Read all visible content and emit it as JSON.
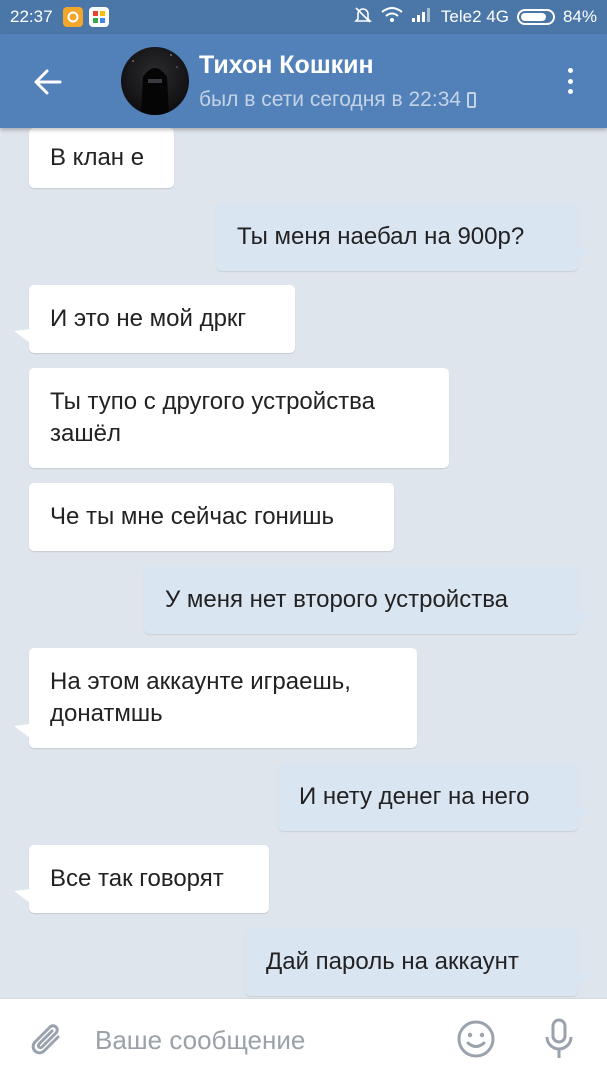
{
  "status_bar": {
    "time": "22:37",
    "carrier": "Tele2 4G",
    "battery": "84%",
    "battery_level": 0.84,
    "icons": [
      "orange-app-notification-icon",
      "colorful-app-notification-icon",
      "mute-icon",
      "wifi-icon",
      "signal-icon",
      "battery-icon"
    ]
  },
  "header": {
    "contact_name": "Тихон Кошкин",
    "contact_status": "был в сети сегодня в 22:34",
    "icons": [
      "back-arrow-icon",
      "avatar",
      "mobile-phone-icon",
      "more-vertical-icon"
    ]
  },
  "colors": {
    "header_bg": "#5181b8",
    "status_bar_bg": "#4a76a8",
    "chat_bg": "#dfe5ec",
    "incoming_bubble": "#ffffff",
    "outgoing_bubble": "#dae5f2"
  },
  "messages": [
    {
      "direction": "in",
      "text": "В клан е",
      "tail": false
    },
    {
      "direction": "out",
      "text": "Ты меня наебал на 900р?",
      "tail": true
    },
    {
      "direction": "in",
      "text": "И это не мой дркг",
      "tail": true
    },
    {
      "direction": "in",
      "text": "Ты тупо с другого устройства зашёл",
      "tail": false
    },
    {
      "direction": "in",
      "text": "Че ты мне сейчас гонишь",
      "tail": false
    },
    {
      "direction": "out",
      "text": "У меня нет второго устройства",
      "tail": true
    },
    {
      "direction": "in",
      "text": "На этом аккаунте играешь, донатмшь",
      "tail": true
    },
    {
      "direction": "out",
      "text": "И нету денег на него",
      "tail": true
    },
    {
      "direction": "in",
      "text": "Все так говорят",
      "tail": true
    },
    {
      "direction": "out",
      "text": "Дай пароль на аккаунт",
      "tail": true
    }
  ],
  "composer": {
    "placeholder": "Ваше сообщение",
    "value": "",
    "icons": [
      "attach-paperclip-icon",
      "emoji-smile-icon",
      "microphone-icon"
    ]
  }
}
